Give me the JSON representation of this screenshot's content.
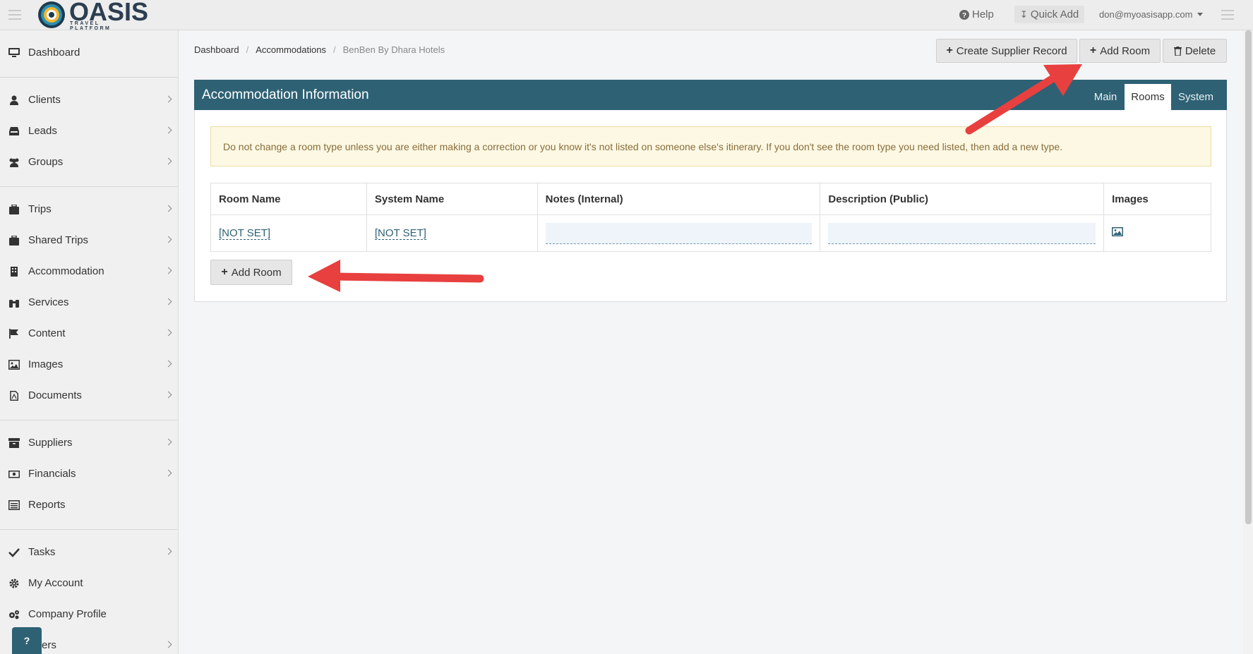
{
  "header": {
    "logo_text": "OASIS",
    "logo_subtext": "TRAVEL PLATFORM",
    "help_label": "Help",
    "quick_add_label": "Quick Add",
    "user_email": "don@myoasisapp.com"
  },
  "sidebar": {
    "items": [
      {
        "label": "Dashboard"
      },
      {
        "label": "Clients"
      },
      {
        "label": "Leads"
      },
      {
        "label": "Groups"
      },
      {
        "label": "Trips"
      },
      {
        "label": "Shared Trips"
      },
      {
        "label": "Accommodation"
      },
      {
        "label": "Services"
      },
      {
        "label": "Content"
      },
      {
        "label": "Images"
      },
      {
        "label": "Documents"
      },
      {
        "label": "Suppliers"
      },
      {
        "label": "Financials"
      },
      {
        "label": "Reports"
      },
      {
        "label": "Tasks"
      },
      {
        "label": "My Account"
      },
      {
        "label": "Company Profile"
      },
      {
        "label": "ers"
      }
    ],
    "help_fab": "?"
  },
  "breadcrumb": {
    "items": [
      "Dashboard",
      "Accommodations",
      "BenBen By Dhara Hotels"
    ]
  },
  "actions": {
    "create_supplier": "Create Supplier Record",
    "add_room": "Add Room",
    "delete": "Delete"
  },
  "panel": {
    "title": "Accommodation Information",
    "tabs": [
      "Main",
      "Rooms",
      "System"
    ],
    "active_tab": "Rooms"
  },
  "alert": {
    "text": "Do not change a room type unless you are either making a correction or you know it's not listed on someone else's itinerary. If you don't see the room type you need listed, then add a new type."
  },
  "table": {
    "headers": [
      "Room Name",
      "System Name",
      "Notes (Internal)",
      "Description (Public)",
      "Images"
    ],
    "rows": [
      {
        "room_name": "[NOT SET]",
        "system_name": "[NOT SET]",
        "notes": "",
        "description": ""
      }
    ]
  },
  "add_room_button": "Add Room",
  "colors": {
    "brand": "#2e6174",
    "arrow": "#e8403f",
    "alert_bg": "#fcf8e3"
  }
}
